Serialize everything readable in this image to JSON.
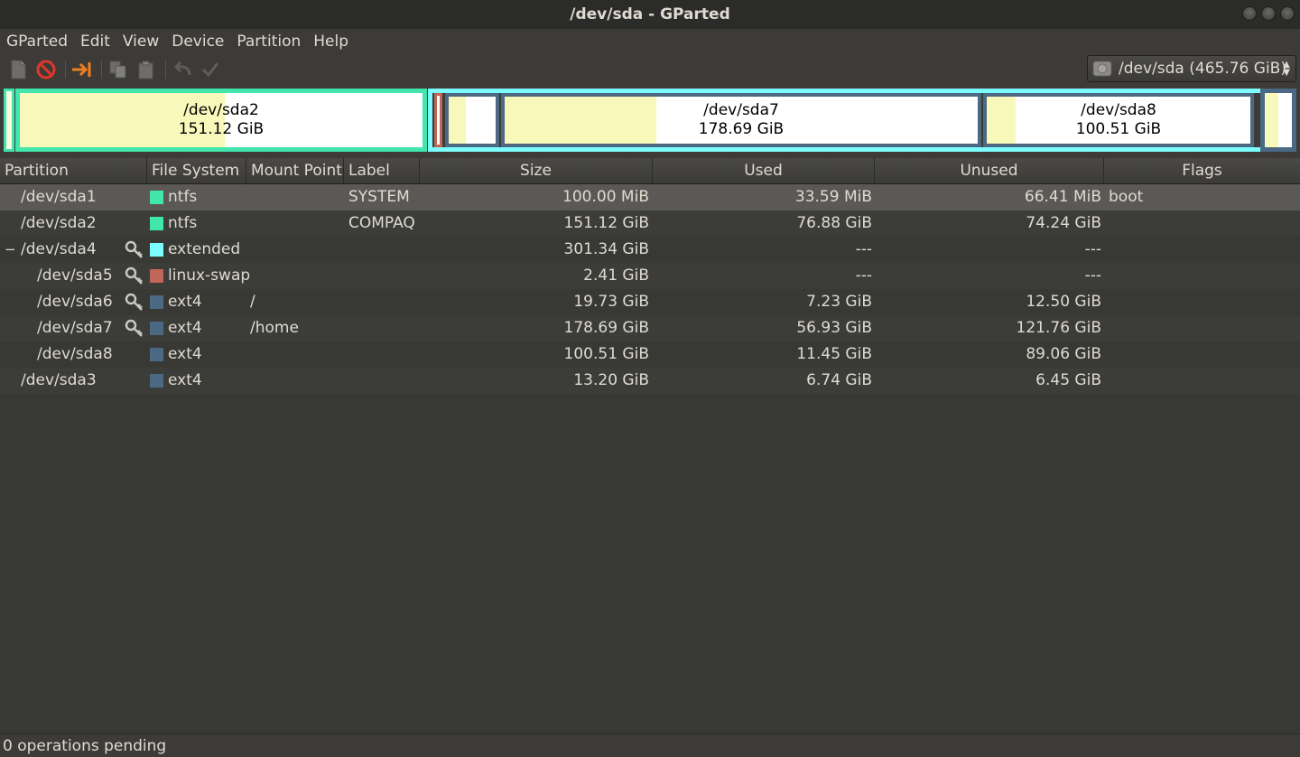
{
  "window": {
    "title": "/dev/sda - GParted"
  },
  "menu": [
    "GParted",
    "Edit",
    "View",
    "Device",
    "Partition",
    "Help"
  ],
  "toolbar": {
    "items": [
      "new-icon",
      "delete-icon",
      "resize-move-icon",
      "copy-icon",
      "paste-icon",
      "undo-icon",
      "apply-icon"
    ]
  },
  "device": {
    "name": "/dev/sda",
    "size": "(465.76 GiB)"
  },
  "disk_map": {
    "sda2": {
      "name": "/dev/sda2",
      "size": "151.12 GiB",
      "used_fraction": 0.51
    },
    "sda7": {
      "name": "/dev/sda7",
      "size": "178.69 GiB",
      "used_fraction": 0.32
    },
    "sda8": {
      "name": "/dev/sda8",
      "size": "100.51 GiB",
      "used_fraction": 0.11
    },
    "sda6": {
      "used_fraction": 0.37
    },
    "sda3": {
      "used_fraction": 0.51
    }
  },
  "colors": {
    "ntfs": "#42e5ac",
    "extended": "#7dfcfe",
    "linux-swap": "#c1665a",
    "ext4": "#4b6983",
    "used": "#f8f8ba"
  },
  "columns": [
    "Partition",
    "File System",
    "Mount Point",
    "Label",
    "Size",
    "Used",
    "Unused",
    "Flags"
  ],
  "rows": [
    {
      "partition": "/dev/sda1",
      "fs": "ntfs",
      "fs_color": "#42e5ac",
      "mount": "",
      "label": "SYSTEM",
      "size": "100.00 MiB",
      "used": "33.59 MiB",
      "unused": "66.41 MiB",
      "flags": "boot",
      "locked": false,
      "level": 0
    },
    {
      "partition": "/dev/sda2",
      "fs": "ntfs",
      "fs_color": "#42e5ac",
      "mount": "",
      "label": "COMPAQ",
      "size": "151.12 GiB",
      "used": "76.88 GiB",
      "unused": "74.24 GiB",
      "flags": "",
      "locked": false,
      "level": 0
    },
    {
      "partition": "/dev/sda4",
      "fs": "extended",
      "fs_color": "#7dfcfe",
      "mount": "",
      "label": "",
      "size": "301.34 GiB",
      "used": "---",
      "unused": "---",
      "flags": "",
      "locked": true,
      "level": 0,
      "expander": "−"
    },
    {
      "partition": "/dev/sda5",
      "fs": "linux-swap",
      "fs_color": "#c1665a",
      "mount": "",
      "label": "",
      "size": "2.41 GiB",
      "used": "---",
      "unused": "---",
      "flags": "",
      "locked": true,
      "level": 1
    },
    {
      "partition": "/dev/sda6",
      "fs": "ext4",
      "fs_color": "#4b6983",
      "mount": "/",
      "label": "",
      "size": "19.73 GiB",
      "used": "7.23 GiB",
      "unused": "12.50 GiB",
      "flags": "",
      "locked": true,
      "level": 1
    },
    {
      "partition": "/dev/sda7",
      "fs": "ext4",
      "fs_color": "#4b6983",
      "mount": "/home",
      "label": "",
      "size": "178.69 GiB",
      "used": "56.93 GiB",
      "unused": "121.76 GiB",
      "flags": "",
      "locked": true,
      "level": 1
    },
    {
      "partition": "/dev/sda8",
      "fs": "ext4",
      "fs_color": "#4b6983",
      "mount": "",
      "label": "",
      "size": "100.51 GiB",
      "used": "11.45 GiB",
      "unused": "89.06 GiB",
      "flags": "",
      "locked": false,
      "level": 1
    },
    {
      "partition": "/dev/sda3",
      "fs": "ext4",
      "fs_color": "#4b6983",
      "mount": "",
      "label": "",
      "size": "13.20 GiB",
      "used": "6.74 GiB",
      "unused": "6.45 GiB",
      "flags": "",
      "locked": false,
      "level": 0
    }
  ],
  "status": {
    "text": "0 operations pending"
  }
}
